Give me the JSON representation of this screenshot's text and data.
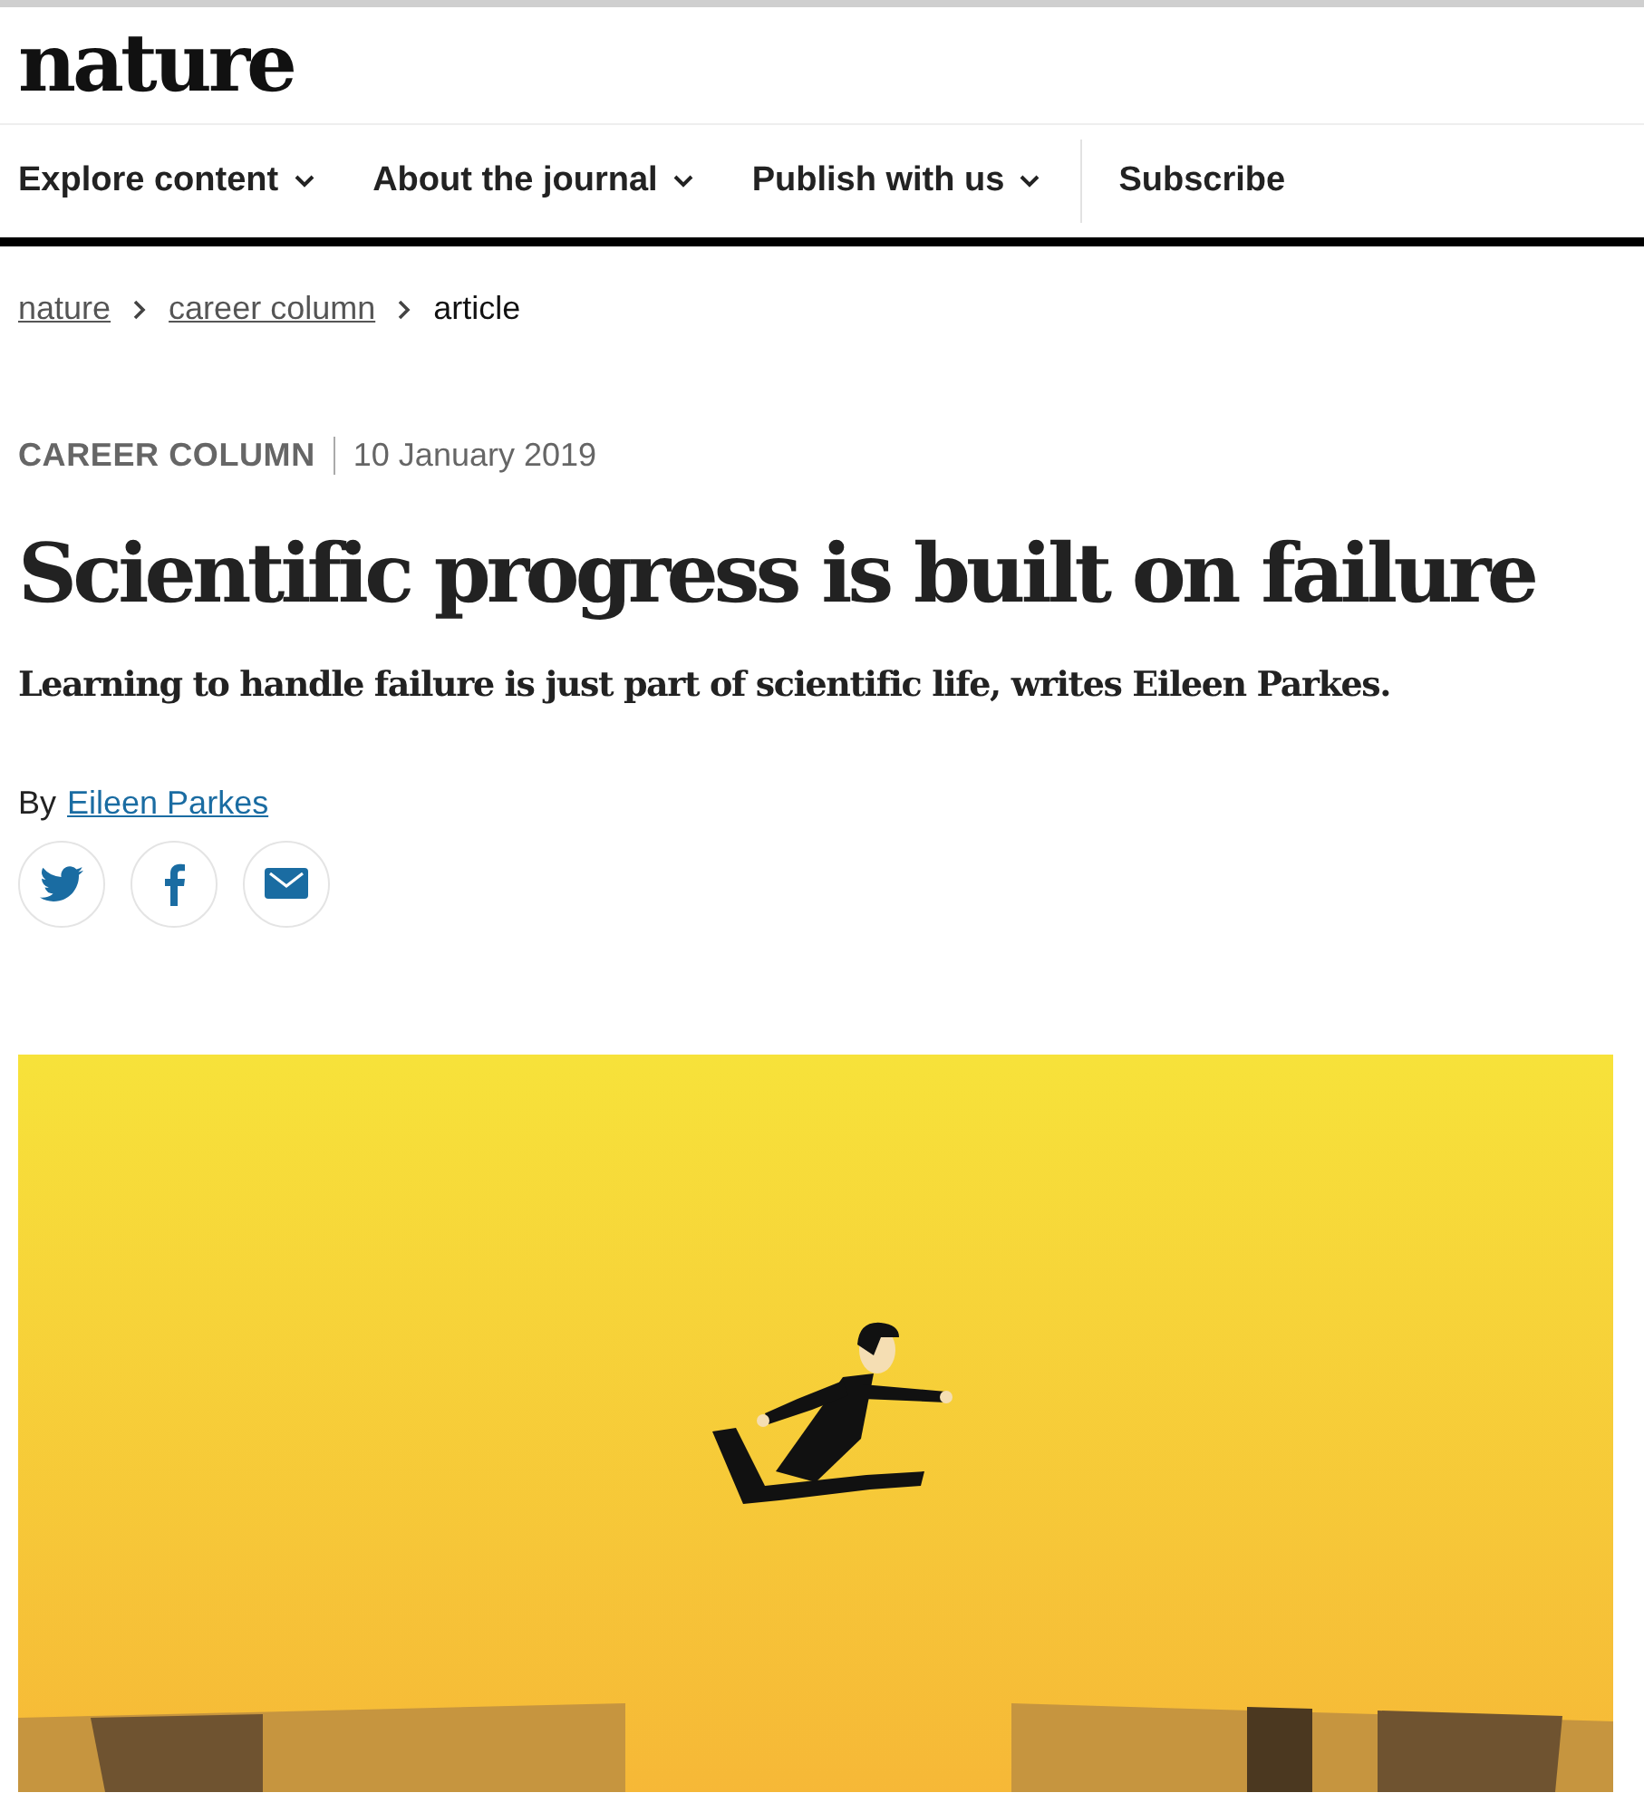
{
  "logo": "nature",
  "nav": [
    {
      "label": "Explore content",
      "kind": "menu"
    },
    {
      "label": "About the journal",
      "kind": "menu"
    },
    {
      "label": "Publish with us",
      "kind": "menu"
    },
    {
      "label": "Subscribe",
      "kind": "link"
    }
  ],
  "breadcrumbs": [
    {
      "label": "nature",
      "kind": "link"
    },
    {
      "label": "career column",
      "kind": "link"
    },
    {
      "label": "article",
      "kind": "current"
    }
  ],
  "article": {
    "category": "CAREER COLUMN",
    "date": "10 January 2019",
    "title": "Scientific progress is built on failure",
    "standfirst": "Learning to handle failure is just part of scientific life, writes Eileen Parkes.",
    "byline_prefix": "By",
    "author": "Eileen Parkes"
  },
  "share": [
    {
      "kind": "twitter"
    },
    {
      "kind": "facebook"
    },
    {
      "kind": "email"
    }
  ]
}
